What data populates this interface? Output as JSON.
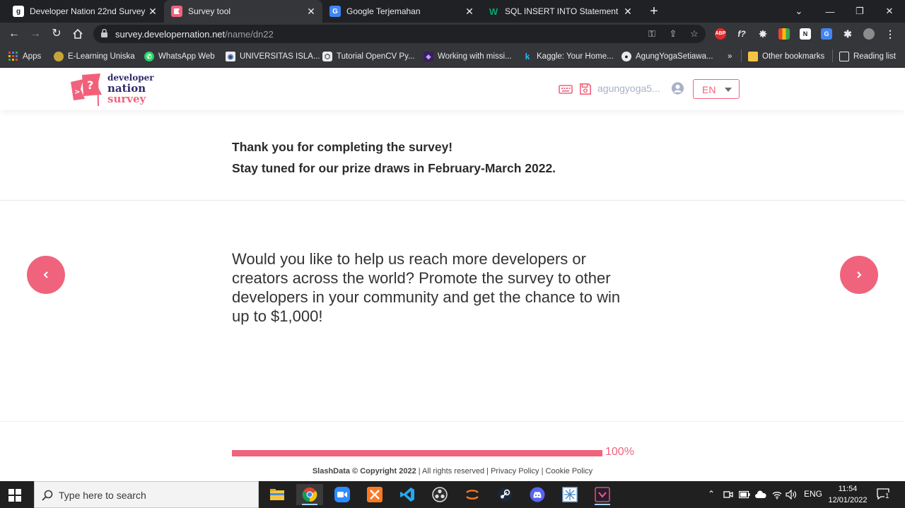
{
  "browser": {
    "tabs": [
      {
        "title": "Developer Nation 22nd Survey -",
        "favicon": "g",
        "favicon_color": "#5f6b7a"
      },
      {
        "title": "Survey tool",
        "favicon": "dn-flag",
        "favicon_color": "#f0637d"
      },
      {
        "title": "Google Terjemahan",
        "favicon": "translate",
        "favicon_color": "#4285f4"
      },
      {
        "title": "SQL INSERT INTO Statement",
        "favicon": "w",
        "favicon_color": "#04aa6d"
      }
    ],
    "address": {
      "host": "survey.developernation.net",
      "path": "/name/dn22"
    },
    "bookmarks": [
      "Apps",
      "E-Learning Uniska",
      "WhatsApp Web",
      "UNIVERSITAS ISLA...",
      "Tutorial OpenCV Py...",
      "Working with missi...",
      "Kaggle: Your Home...",
      "AgungYogaSetiawa...",
      "»",
      "Other bookmarks",
      "Reading list"
    ],
    "extensions": {
      "abp": "ABP",
      "fx": "f?"
    }
  },
  "header": {
    "logo": {
      "line1": "developer",
      "line2": "nation",
      "line3": "survey"
    },
    "user": "agungyoga5...",
    "language": "EN"
  },
  "content": {
    "thanks_line1": "Thank you for completing the survey!",
    "thanks_line2": "Stay tuned for our prize draws in February-March 2022.",
    "promo": "Would you like to help us reach more developers or creators across the world? Promote the survey to other developers in your community and get the chance to win up to $1,000!"
  },
  "progress": {
    "value": 100,
    "label": "100%"
  },
  "footer": {
    "company": "SlashData © Copyright 2022",
    "rights": "| All rights reserved |",
    "privacy": "Privacy Policy",
    "sep": "|",
    "cookie": "Cookie Policy"
  },
  "taskbar": {
    "search_placeholder": "Type here to search",
    "language": "ENG",
    "time": "11:54",
    "date": "12/01/2022",
    "notifications": "1"
  },
  "colors": {
    "accent": "#f0637d",
    "logo_navy": "#2f2a6b",
    "username": "#a9b0c9"
  }
}
